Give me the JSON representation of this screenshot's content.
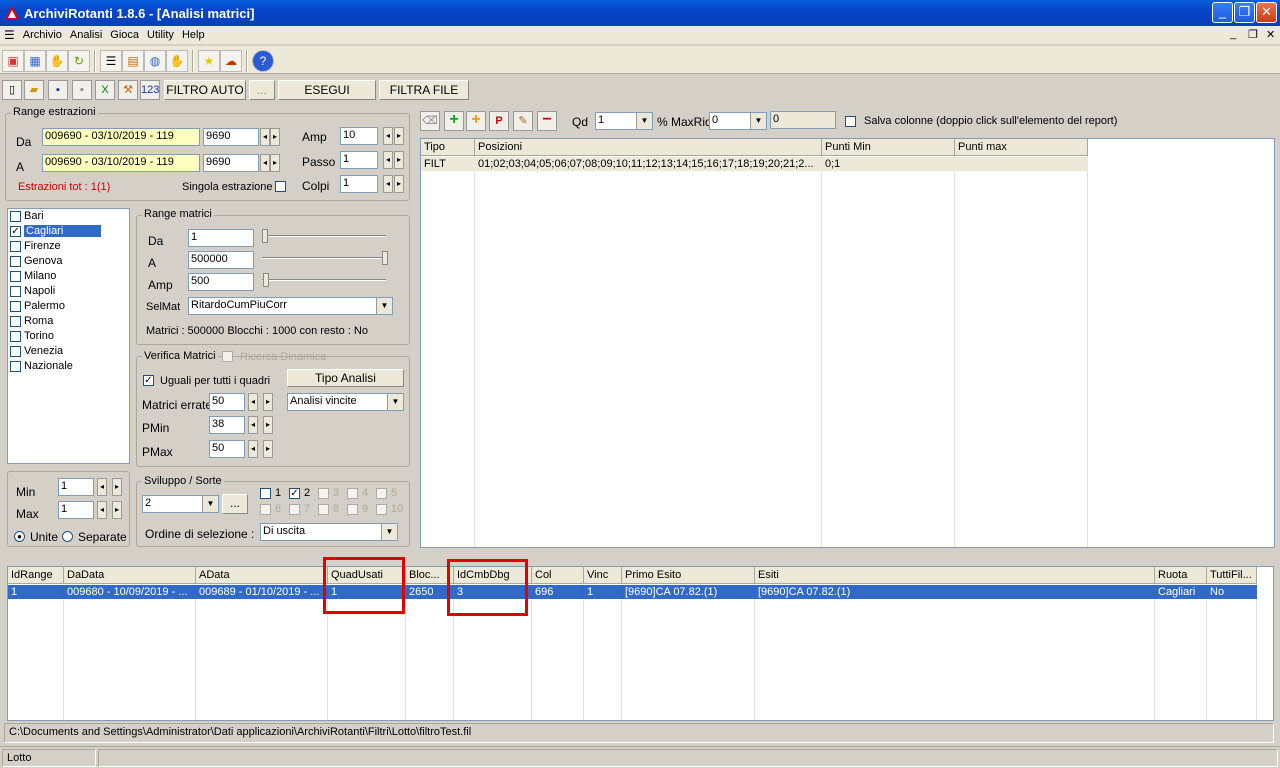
{
  "window": {
    "title": "ArchiviRotanti  1.8.6 - [Analisi matrici]"
  },
  "menu": [
    "Archivio",
    "Analisi",
    "Gioca",
    "Utility",
    "Help"
  ],
  "toolbar2": {
    "btn_123": "123",
    "filtro_auto": "FILTRO AUTO",
    "dots": "...",
    "esegui": "ESEGUI",
    "filtra_file": "FILTRA FILE"
  },
  "range_estrazioni": {
    "title": "Range estrazioni",
    "da_label": "Da",
    "da_value": "009690 - 03/10/2019 - 119",
    "da_num": "9690",
    "a_label": "A",
    "a_value": "009690 - 03/10/2019 - 119",
    "a_num": "9690",
    "amp_label": "Amp",
    "amp_value": "10",
    "passo_label": "Passo",
    "passo_value": "1",
    "colpi_label": "Colpi",
    "colpi_value": "1",
    "tot": "Estrazioni tot : 1(1)",
    "singola": "Singola estrazione"
  },
  "ruote": [
    {
      "name": "Bari",
      "checked": false
    },
    {
      "name": "Cagliari",
      "checked": true
    },
    {
      "name": "Firenze",
      "checked": false
    },
    {
      "name": "Genova",
      "checked": false
    },
    {
      "name": "Milano",
      "checked": false
    },
    {
      "name": "Napoli",
      "checked": false
    },
    {
      "name": "Palermo",
      "checked": false
    },
    {
      "name": "Roma",
      "checked": false
    },
    {
      "name": "Torino",
      "checked": false
    },
    {
      "name": "Venezia",
      "checked": false
    },
    {
      "name": "Nazionale",
      "checked": false
    }
  ],
  "range_matrici": {
    "title": "Range matrici",
    "da_label": "Da",
    "da_value": "1",
    "a_label": "A",
    "a_value": "500000",
    "amp_label": "Amp",
    "amp_value": "500",
    "selmat_label": "SelMat",
    "selmat_value": "RitardoCumPiuCorr",
    "info": "Matrici : 500000 Blocchi : 1000 con resto : No"
  },
  "verifica": {
    "title": "Verifica Matrici",
    "ricerca": "Ricerca Dinamica",
    "uguali": "Uguali per tutti i quadri",
    "tipo_analisi": "Tipo Analisi",
    "errate_label": "Matrici errate",
    "errate_value": "50",
    "analisi_value": "Analisi vincite",
    "pmin_label": "PMin",
    "pmin_value": "38",
    "pmax_label": "PMax",
    "pmax_value": "50"
  },
  "minmax": {
    "min_label": "Min",
    "min_value": "1",
    "max_label": "Max",
    "max_value": "1",
    "unite": "Unite",
    "separate": "Separate"
  },
  "sviluppo": {
    "title": "Sviluppo / Sorte",
    "value": "2",
    "dots": "...",
    "nums": [
      "1",
      "2",
      "3",
      "4",
      "5",
      "6",
      "7",
      "8",
      "9",
      "10"
    ],
    "ordine_label": "Ordine di selezione :",
    "ordine_value": "Di uscita"
  },
  "report_toolbar": {
    "qd_label": "Qd",
    "qd_value": "1",
    "maxrid_label": "% MaxRid",
    "maxrid_value": "0",
    "extra_value": "0",
    "salva": "Salva colonne (doppio click sull'elemento del report)"
  },
  "report": {
    "headers": [
      "Tipo",
      "Posizioni",
      "Punti Min",
      "Punti max"
    ],
    "rows": [
      [
        "FILT",
        "01;02;03;04;05;06;07;08;09;10;11;12;13;14;15;16;17;18;19;20;21;2...",
        "0;1",
        ""
      ]
    ]
  },
  "results": {
    "headers": [
      "IdRange",
      "DaData",
      "AData",
      "QuadUsati",
      "Bloc...",
      "IdCmbDbg",
      "Col",
      "Vinc",
      "Primo Esito",
      "Esiti",
      "Ruota",
      "TuttiFil..."
    ],
    "rows": [
      [
        "1",
        "009680 - 10/09/2019 - ...",
        "009689 - 01/10/2019 - ...",
        "1",
        "2650",
        "3",
        "696",
        "1",
        "[9690]CA 07.82.(1)",
        "[9690]CA 07.82.(1)",
        "Cagliari",
        "No"
      ]
    ]
  },
  "path": "C:\\Documents and Settings\\Administrator\\Dati applicazioni\\ArchiviRotanti\\Filtri\\Lotto\\filtroTest.fil",
  "status": "Lotto",
  "colors": {
    "title": "#0a5ddb",
    "selection": "#316ac5",
    "highlight": "#e00000",
    "yellow_field": "#ffffc0"
  }
}
